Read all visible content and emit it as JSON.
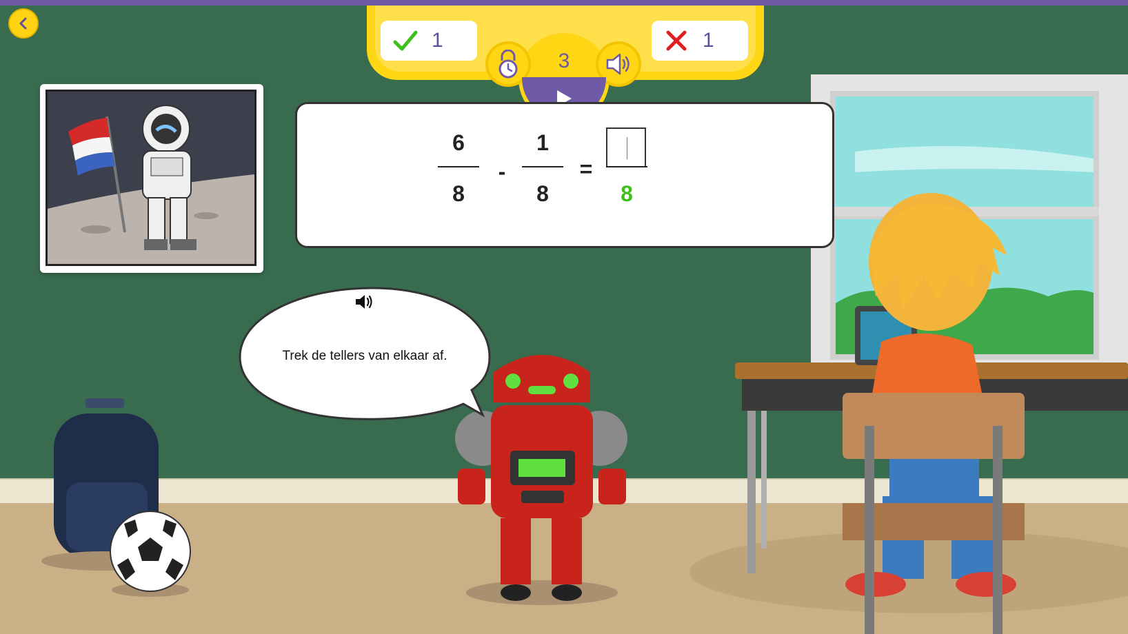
{
  "hud": {
    "correct_count": "1",
    "wrong_count": "1",
    "question_counter": "3"
  },
  "equation": {
    "left": {
      "numerator": "6",
      "denominator": "8"
    },
    "operator": "-",
    "right": {
      "numerator": "1",
      "denominator": "8"
    },
    "equals": "=",
    "answer": {
      "numerator": "",
      "denominator": "8"
    }
  },
  "speech": {
    "text": "Trek de tellers van elkaar af."
  },
  "colors": {
    "hud_yellow": "#ffd614",
    "accent_purple": "#6f5aa8",
    "board_green": "#396b4e",
    "correct_green": "#3fbf1c",
    "wrong_red": "#e02020",
    "robot_red": "#c8241c"
  },
  "icons": {
    "back": "chevron-left-icon",
    "correct": "check-icon",
    "wrong": "cross-icon",
    "timer_lock": "lock-clock-icon",
    "sound": "speaker-icon",
    "play": "play-icon",
    "speech_sound": "speaker-icon"
  }
}
